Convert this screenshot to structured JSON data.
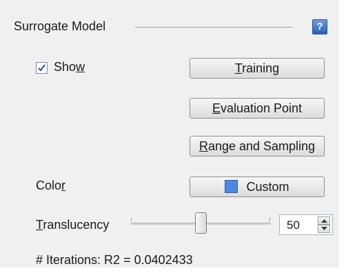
{
  "section": {
    "title": "Surrogate Model",
    "help_label": "?"
  },
  "show": {
    "label_pre": "Sho",
    "label_u": "w",
    "checked": true
  },
  "buttons": {
    "training": {
      "u": "T",
      "rest": "raining"
    },
    "evaluation": {
      "u": "E",
      "rest": "valuation Point"
    },
    "range": {
      "u": "R",
      "rest": "ange and Sampling"
    },
    "custom": "Custom"
  },
  "color": {
    "label_pre": "Colo",
    "label_u": "r",
    "swatch": "#4f86e0"
  },
  "translucency": {
    "label_u": "T",
    "label_rest": "ranslucency",
    "value": "50",
    "slider_fraction": 0.5
  },
  "status": {
    "iterations": "# Iterations: R2 = 0.0402433"
  }
}
